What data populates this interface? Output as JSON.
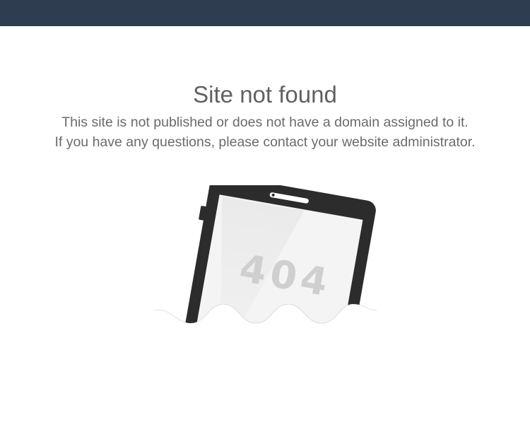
{
  "header": {
    "bar_color": "#2e3e50"
  },
  "main": {
    "title": "Site not found",
    "description_line1": "This site is not published or does not have a domain assigned to it.",
    "description_line2": "If you have any questions, please contact your website administrator."
  },
  "illustration": {
    "screen_text": "404",
    "icon": "tablet-404-illustration"
  }
}
